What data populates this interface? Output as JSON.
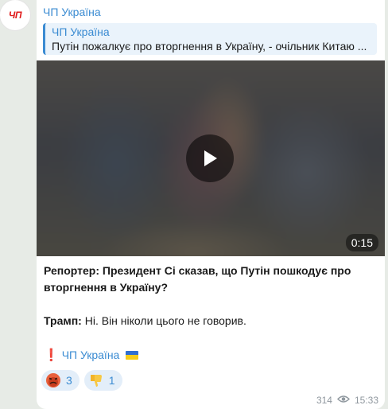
{
  "channel": {
    "name": "ЧП Україна",
    "avatar_text": "ЧП"
  },
  "reply": {
    "title": "ЧП Україна",
    "text": "Путін пожалкує про вторгнення в Україну, - очільник Китаю ..."
  },
  "video": {
    "duration": "0:15",
    "play_icon": "play-icon"
  },
  "caption": {
    "q_label": "Репортер: Президент Сі сказав, що Путін пошкодує про вторгнення в Україну?",
    "a_label": "Трамп:",
    "a_text": " Ні. Він ніколи цього не говорив."
  },
  "signature": {
    "mark": "❗",
    "text": "ЧП Україна"
  },
  "reactions": [
    {
      "icon": "angry-face-icon",
      "count": "3"
    },
    {
      "icon": "thumbs-down-icon",
      "count": "1"
    }
  ],
  "meta": {
    "views": "314",
    "time": "15:33"
  },
  "colors": {
    "accent": "#3a8bd2",
    "avatar_red": "#e01b1b"
  }
}
